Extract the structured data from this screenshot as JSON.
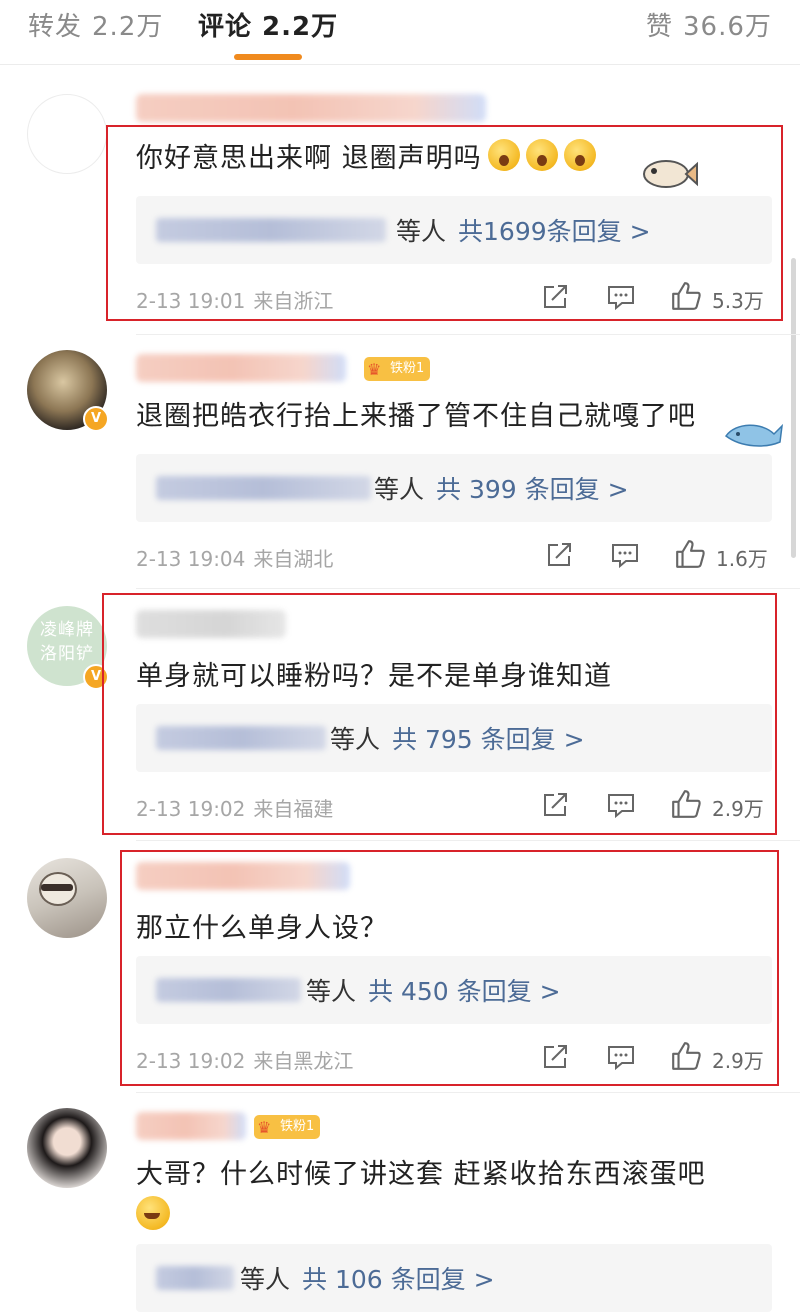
{
  "tabs": {
    "repost": {
      "label": "转发",
      "count": "2.2万"
    },
    "comment": {
      "label": "评论",
      "count": "2.2万"
    },
    "like": {
      "label": "赞",
      "count": "36.6万"
    }
  },
  "comments": [
    {
      "text": "你好意思出来啊 退圈声明吗",
      "reply_suffix": "等人",
      "reply_link": "共1699条回复 >",
      "time": "2-13 19:01",
      "source": "来自浙江",
      "likes": "5.3万",
      "highlighted": true
    },
    {
      "badge": "铁粉1",
      "text": "退圈把皓衣行抬上来播了管不住自己就嘎了吧",
      "reply_suffix": "等人",
      "reply_link": "共 399 条回复 >",
      "time": "2-13 19:04",
      "source": "来自湖北",
      "likes": "1.6万",
      "highlighted": false
    },
    {
      "avatar_text": "凌峰牌洛阳铲",
      "text": "单身就可以睡粉吗？是不是单身谁知道",
      "reply_suffix": "等人",
      "reply_link": "共 795 条回复 >",
      "time": "2-13 19:02",
      "source": "来自福建",
      "likes": "2.9万",
      "highlighted": true
    },
    {
      "text": "那立什么单身人设？",
      "reply_suffix": "等人",
      "reply_link": "共 450 条回复 >",
      "time": "2-13 19:02",
      "source": "来自黑龙江",
      "likes": "2.9万",
      "highlighted": true
    },
    {
      "badge": "铁粉1",
      "text": "大哥？什么时候了讲这套 赶紧收拾东西滚蛋吧",
      "reply_suffix": "等人",
      "reply_link": "共 106 条回复 >",
      "highlighted": false
    }
  ],
  "icons": {
    "share": "share-icon",
    "comment": "comment-icon",
    "like": "thumbs-up-icon",
    "verified": "verified-v-icon",
    "fan_crown": "crown-icon"
  },
  "colors": {
    "accent": "#f08a1e",
    "link": "#4c6b96",
    "highlight_border": "#d8232a",
    "badge": "#f8c043"
  }
}
